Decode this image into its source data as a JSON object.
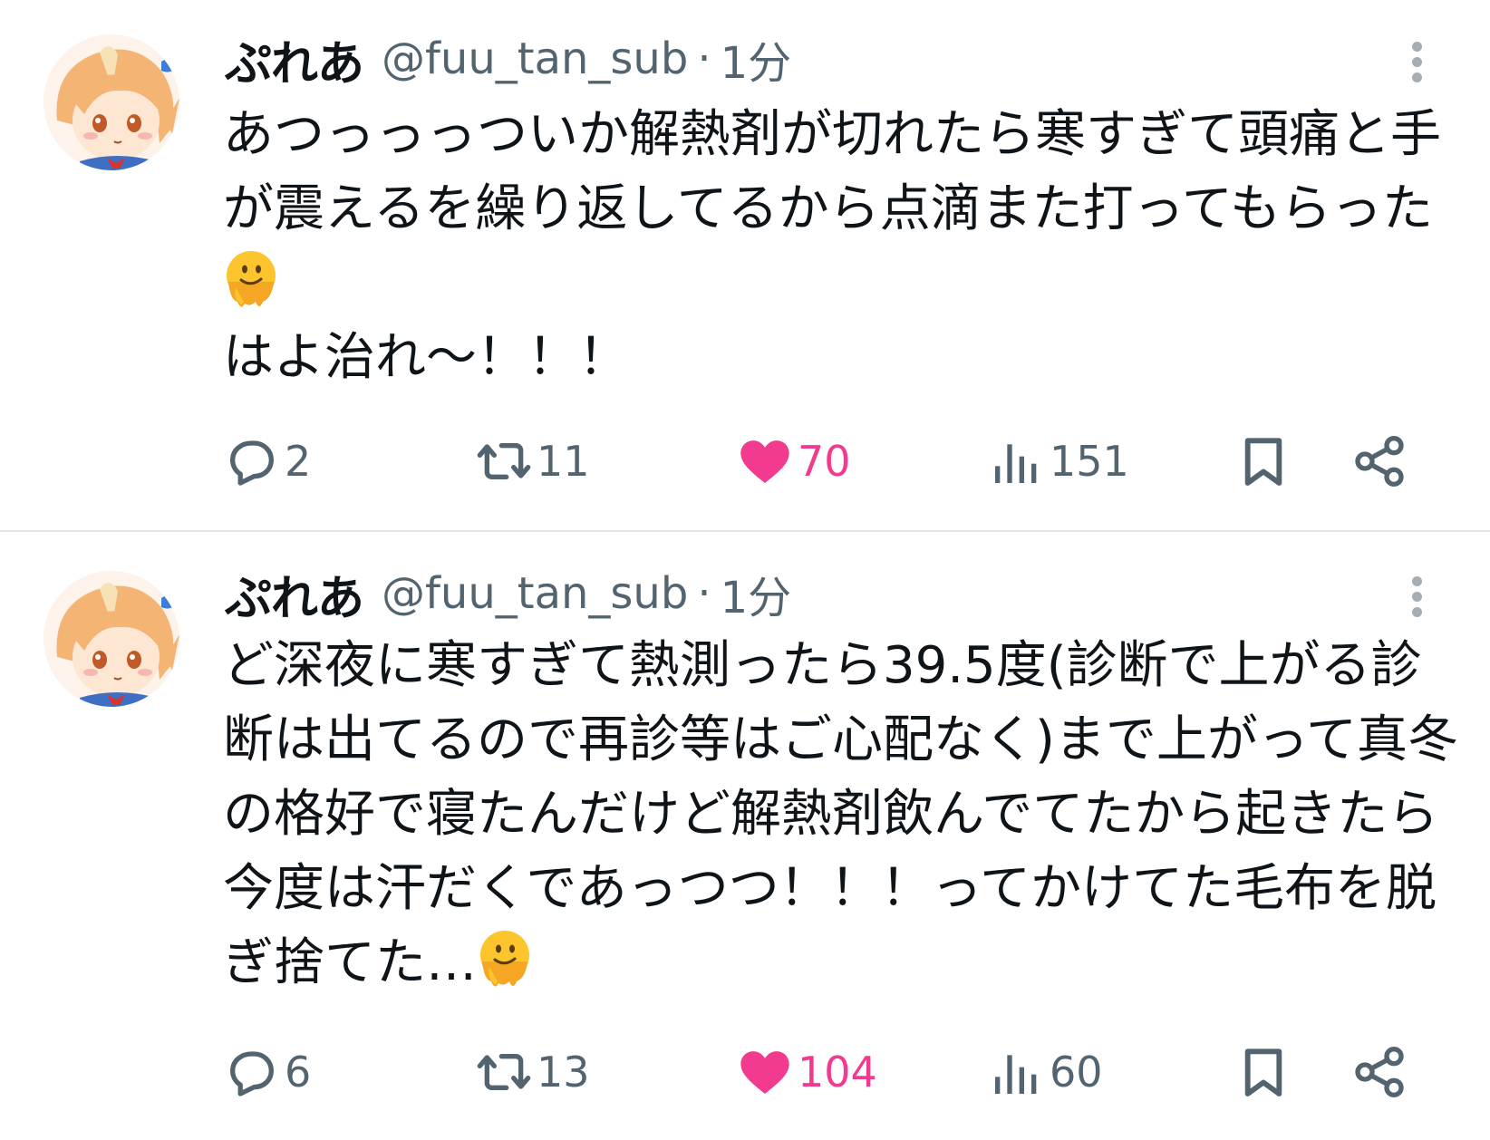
{
  "tweets": [
    {
      "name": "ぷれあ",
      "handle": "@fuu_tan_sub",
      "separator": "·",
      "time": "1分",
      "text_parts": [
        "あつっっっついか解熱剤が切れたら寒すぎて頭痛と手が震えるを繰り返してるから点滴また打ってもらった",
        "\nはよ治れ〜！！！"
      ],
      "emoji": "melting-face-emoji",
      "replies": "2",
      "retweets": "11",
      "likes": "70",
      "views": "151"
    },
    {
      "name": "ぷれあ",
      "handle": "@fuu_tan_sub",
      "separator": "·",
      "time": "1分",
      "text_parts": [
        "ど深夜に寒すぎて熱測ったら39.5度(診断で上がる診断は出てるので再診等はご心配なく)まで上がって真冬の格好で寝たんだけど解熱剤飲んでてたから起きたら今度は汗だくであっつつ！！！ってかけてた毛布を脱ぎ捨てた…",
        ""
      ],
      "emoji": "melting-face-emoji",
      "replies": "6",
      "retweets": "13",
      "likes": "104",
      "views": "60"
    }
  ],
  "colors": {
    "text": "#0f1419",
    "secondary": "#536471",
    "like": "#f23a8e",
    "divider": "#e4e7ea"
  }
}
